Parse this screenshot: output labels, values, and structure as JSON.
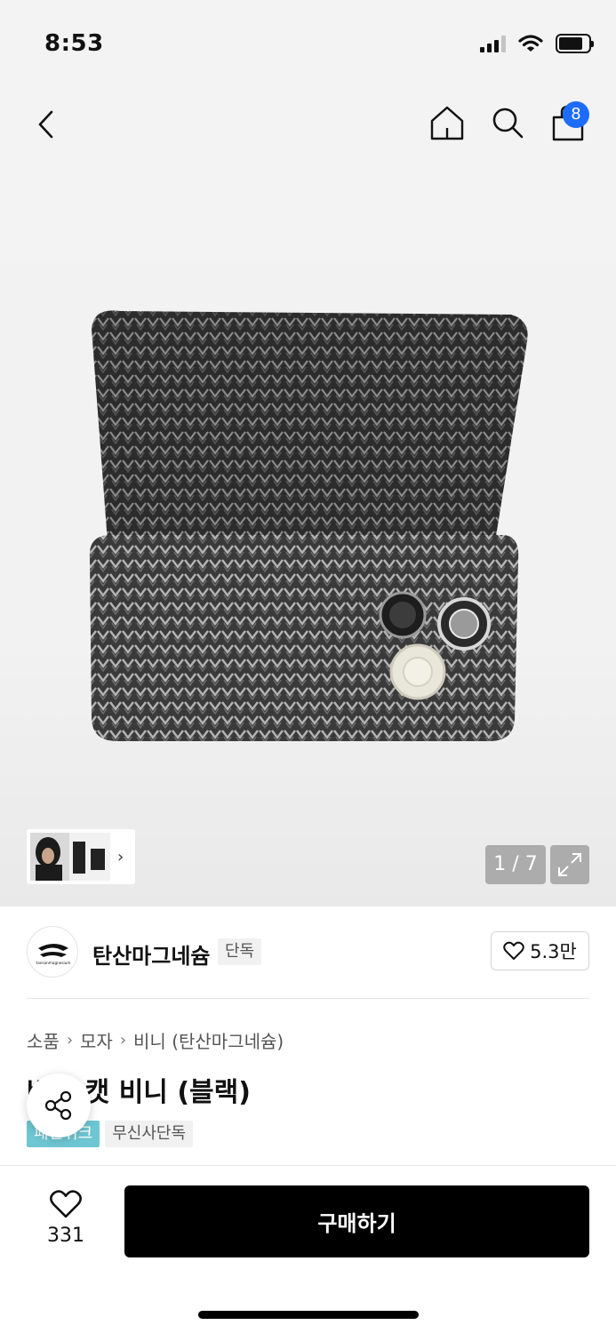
{
  "status_bar": {
    "time": "8:53"
  },
  "nav": {
    "cart_count": "8"
  },
  "gallery": {
    "pager_text": "1 / 7"
  },
  "brand": {
    "name": "탄산마그네슘",
    "tag": "단독",
    "likes": "5.3만",
    "logo_text": "tansanmagnesium"
  },
  "breadcrumb": {
    "items": [
      "소품",
      "모자",
      "비니 (탄산마그네슘)"
    ]
  },
  "product": {
    "title": "버튼 캣 비니 (블랙)",
    "tags": [
      "패션위크",
      "무신사단독"
    ]
  },
  "bottom_bar": {
    "like_count": "331",
    "buy_label": "구매하기"
  },
  "colors": {
    "accent_badge": "#1d6bff",
    "tag_teal": "#6ec6d2",
    "buy_button": "#000000"
  },
  "icons": [
    "back-icon",
    "home-icon",
    "search-icon",
    "cart-icon",
    "expand-icon",
    "heart-icon",
    "share-icon",
    "chevron-right-icon"
  ]
}
